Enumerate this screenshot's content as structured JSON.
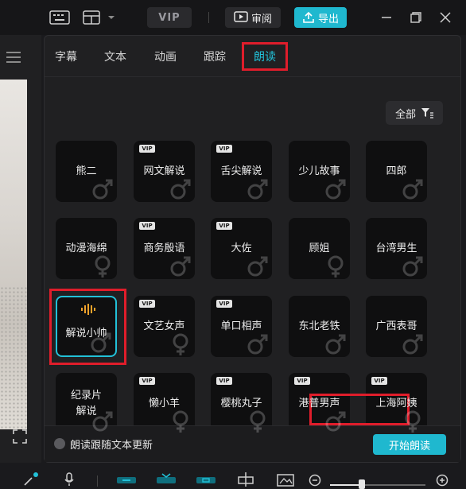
{
  "topbar": {
    "vip_label": "VIP",
    "review_label": "审阅",
    "export_label": "导出"
  },
  "tabs": [
    {
      "label": "字幕",
      "active": false
    },
    {
      "label": "文本",
      "active": false
    },
    {
      "label": "动画",
      "active": false
    },
    {
      "label": "跟踪",
      "active": false
    },
    {
      "label": "朗读",
      "active": true
    }
  ],
  "filter": {
    "label": "全部",
    "icon": "filter-icon"
  },
  "voices": [
    {
      "label": "熊二",
      "vip": false,
      "gender": "male",
      "selected": false
    },
    {
      "label": "网文解说",
      "vip": true,
      "gender": "male",
      "selected": false
    },
    {
      "label": "舌尖解说",
      "vip": true,
      "gender": "male",
      "selected": false
    },
    {
      "label": "少儿故事",
      "vip": false,
      "gender": "male",
      "selected": false
    },
    {
      "label": "四郎",
      "vip": false,
      "gender": "male",
      "selected": false
    },
    {
      "label": "动漫海绵",
      "vip": false,
      "gender": "female",
      "selected": false
    },
    {
      "label": "商务殷语",
      "vip": true,
      "gender": "male",
      "selected": false
    },
    {
      "label": "大佐",
      "vip": true,
      "gender": "male",
      "selected": false
    },
    {
      "label": "顾姐",
      "vip": false,
      "gender": "female",
      "selected": false
    },
    {
      "label": "台湾男生",
      "vip": false,
      "gender": "male",
      "selected": false
    },
    {
      "label": "解说小帅",
      "vip": false,
      "gender": "male",
      "selected": true
    },
    {
      "label": "文艺女声",
      "vip": true,
      "gender": "female",
      "selected": false
    },
    {
      "label": "单口相声",
      "vip": true,
      "gender": "male",
      "selected": false
    },
    {
      "label": "东北老铁",
      "vip": false,
      "gender": "male",
      "selected": false
    },
    {
      "label": "广西表哥",
      "vip": false,
      "gender": "male",
      "selected": false
    },
    {
      "label": "纪录片\n解说",
      "vip": false,
      "gender": "male",
      "selected": false
    },
    {
      "label": "懒小羊",
      "vip": true,
      "gender": "female",
      "selected": false
    },
    {
      "label": "樱桃丸子",
      "vip": true,
      "gender": "female",
      "selected": false
    },
    {
      "label": "港普男声",
      "vip": true,
      "gender": "male",
      "selected": false
    },
    {
      "label": "上海阿姨",
      "vip": true,
      "gender": "female",
      "selected": false
    }
  ],
  "vip_badge_text": "VIP",
  "follow_text_label": "朗读跟随文本更新",
  "start_button_label": "开始朗读",
  "colors": {
    "accent": "#1fb8cf",
    "highlight": "#e01d2b",
    "background": "#1a1a1d"
  }
}
